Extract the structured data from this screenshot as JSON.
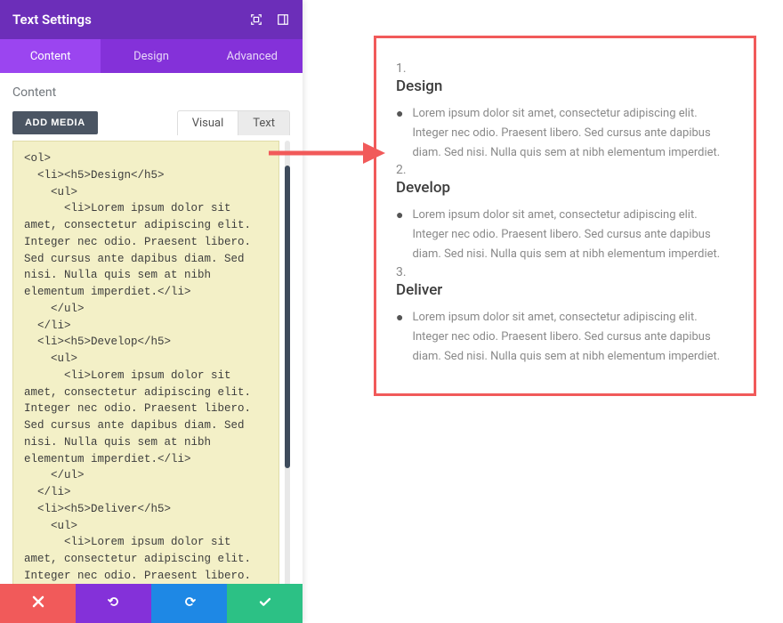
{
  "header": {
    "title": "Text Settings"
  },
  "tabs": {
    "content": "Content",
    "design": "Design",
    "advanced": "Advanced"
  },
  "content": {
    "label": "Content",
    "add_media": "ADD MEDIA",
    "editor_tabs": {
      "visual": "Visual",
      "text": "Text"
    },
    "code": "<ol>\n  <li><h5>Design</h5>\n    <ul>\n      <li>Lorem ipsum dolor sit amet, consectetur adipiscing elit. Integer nec odio. Praesent libero. Sed cursus ante dapibus diam. Sed nisi. Nulla quis sem at nibh elementum imperdiet.</li>\n    </ul>\n  </li>\n  <li><h5>Develop</h5>\n    <ul>\n      <li>Lorem ipsum dolor sit amet, consectetur adipiscing elit. Integer nec odio. Praesent libero. Sed cursus ante dapibus diam. Sed nisi. Nulla quis sem at nibh elementum imperdiet.</li>\n    </ul>\n  </li>\n  <li><h5>Deliver</h5>\n    <ul>\n      <li>Lorem ipsum dolor sit amet, consectetur adipiscing elit. Integer nec odio. Praesent libero. Sed cursus ante dapibus diam. Sed nisi. Nulla quis sem at nibh elementum imperdiet.</li>\n    </ul>\n  </li>\n</ol>"
  },
  "preview": {
    "items": [
      {
        "num": "1.",
        "title": "Design",
        "body": "Lorem ipsum dolor sit amet, consectetur adipiscing elit. Integer nec odio. Praesent libero. Sed cursus ante dapibus diam. Sed nisi. Nulla quis sem at nibh elementum imperdiet."
      },
      {
        "num": "2.",
        "title": "Develop",
        "body": "Lorem ipsum dolor sit amet, consectetur adipiscing elit. Integer nec odio. Praesent libero. Sed cursus ante dapibus diam. Sed nisi. Nulla quis sem at nibh elementum imperdiet."
      },
      {
        "num": "3.",
        "title": "Deliver",
        "body": "Lorem ipsum dolor sit amet, consectetur adipiscing elit. Integer nec odio. Praesent libero. Sed cursus ante dapibus diam. Sed nisi. Nulla quis sem at nibh elementum imperdiet."
      }
    ]
  },
  "colors": {
    "header": "#6c2eb9",
    "tabs": "#8431d9",
    "tab_active": "#9b45f0",
    "cancel": "#f15a5a",
    "undo": "#8431d9",
    "redo": "#1e88e5",
    "confirm": "#2cc185",
    "code_bg": "#f3f0c7",
    "arrow": "#f15a5a"
  }
}
